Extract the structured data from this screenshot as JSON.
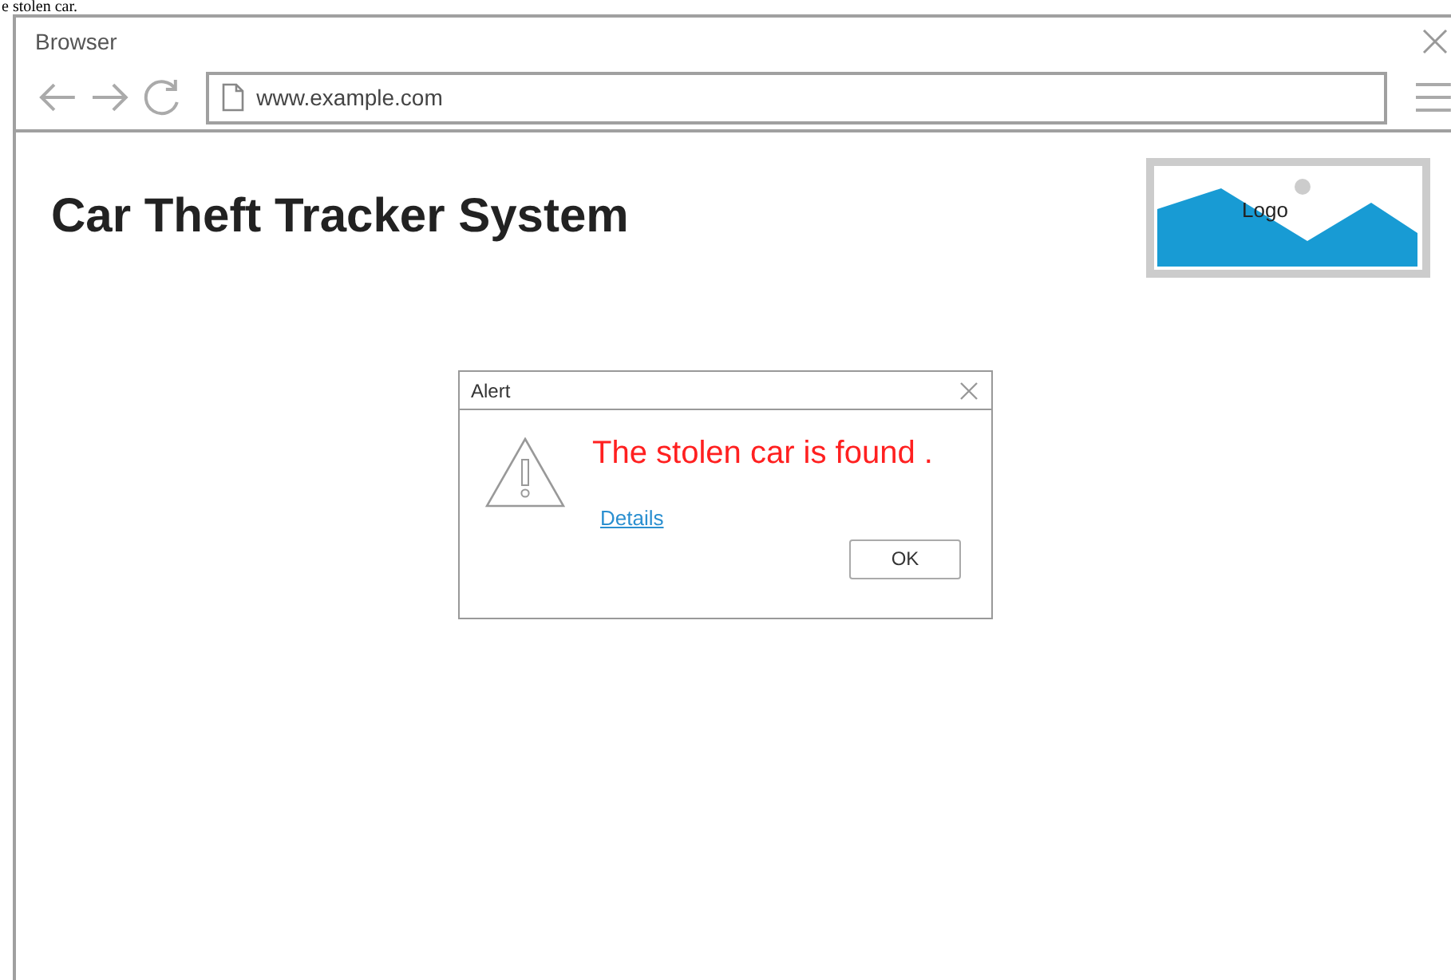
{
  "caption": "e stolen car.",
  "window": {
    "title": "Browser"
  },
  "address_bar": {
    "value": "www.example.com"
  },
  "page": {
    "heading": "Car Theft Tracker System",
    "logo": {
      "label": "Logo"
    }
  },
  "alert": {
    "title": "Alert",
    "message": "The stolen car is found .",
    "link": "Details",
    "buttons": [
      "OK"
    ]
  }
}
